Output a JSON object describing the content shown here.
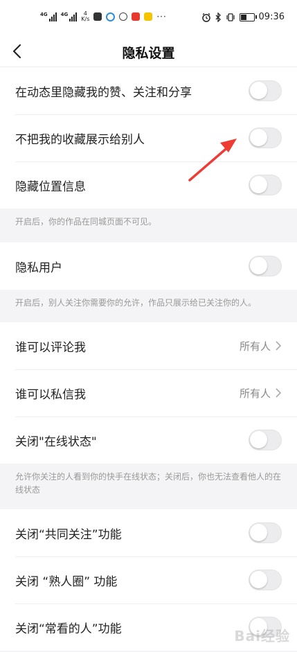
{
  "status_bar": {
    "signal1": "4G",
    "signal2": "4G",
    "speed_value": "4",
    "speed_unit": "K/s",
    "time": "09:36"
  },
  "nav": {
    "title": "隐私设置"
  },
  "group1": {
    "items": [
      {
        "label": "在动态里隐藏我的赞、关注和分享",
        "on": false
      },
      {
        "label": "不把我的收藏展示给别人",
        "on": false
      },
      {
        "label": "隐藏位置信息",
        "on": false
      }
    ],
    "note": "开启后，你的作品在同城页面不可见。"
  },
  "group2": {
    "label": "隐私用户",
    "on": false,
    "note": "开启后，别人关注你需要你的允许，作品只展示给已关注你的人。"
  },
  "group3": {
    "comment_label": "谁可以评论我",
    "comment_value": "所有人",
    "message_label": "谁可以私信我",
    "message_value": "所有人",
    "online_label": "关闭\"在线状态\"",
    "online_on": false,
    "note": "允许你关注的人看到你的快手在线状态；关闭后，你也无法查看他人的在线状态"
  },
  "group4": {
    "items": [
      {
        "label": "关闭“共同关注”功能",
        "on": false
      },
      {
        "label": "关闭 “熟人圈” 功能",
        "on": false
      },
      {
        "label": "关闭“常看的人”功能",
        "on": false
      }
    ]
  },
  "colors": {
    "arrow": "#ee3b34",
    "toggle_off": "#ececee"
  }
}
